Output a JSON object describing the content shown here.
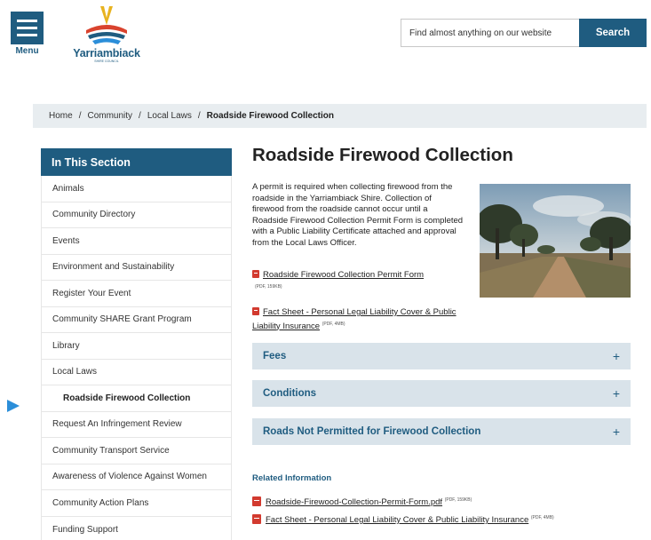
{
  "header": {
    "menu_label": "Menu",
    "logo_name": "Yarriambiack",
    "logo_sub": "SHIRE COUNCIL",
    "search_placeholder": "Find almost anything on our website",
    "search_button": "Search",
    "brand_color": "#1f5c80"
  },
  "breadcrumb": {
    "items": [
      "Home",
      "Community",
      "Local Laws"
    ],
    "current": "Roadside Firewood Collection"
  },
  "sidebar": {
    "heading": "In This Section",
    "items": [
      {
        "label": "Animals"
      },
      {
        "label": "Community Directory"
      },
      {
        "label": "Events"
      },
      {
        "label": "Environment and Sustainability"
      },
      {
        "label": "Register Your Event"
      },
      {
        "label": "Community SHARE Grant Program"
      },
      {
        "label": "Library"
      },
      {
        "label": "Local Laws"
      },
      {
        "label": "Roadside Firewood Collection",
        "active": true
      },
      {
        "label": "Request An Infringement Review"
      },
      {
        "label": "Community Transport Service"
      },
      {
        "label": "Awareness of Violence Against Women"
      },
      {
        "label": "Community Action Plans"
      },
      {
        "label": "Funding Support"
      }
    ]
  },
  "main": {
    "title": "Roadside Firewood Collection",
    "intro": "A permit is required when collecting firewood from the roadside in the Yarriambiack Shire. Collection of firewood from the roadside cannot occur until a Roadside Firewood Collection Permit Form is completed with a Public Liability Certificate attached and approval from the Local Laws Officer.",
    "doc1": {
      "label": "Roadside Firewood Collection Permit Form",
      "meta": "(PDF, 159KB)"
    },
    "doc2": {
      "label": "Fact Sheet - Personal Legal Liability Cover & Public Liability Insurance",
      "meta": "(PDF, 4MB)"
    },
    "accordions": [
      {
        "label": "Fees",
        "icon": "+"
      },
      {
        "label": "Conditions",
        "icon": "+"
      },
      {
        "label": "Roads Not Permitted for Firewood Collection",
        "icon": "+"
      }
    ],
    "related": {
      "title": "Related Information",
      "links": [
        {
          "label": "Roadside-Firewood-Collection-Permit-Form.pdf",
          "meta": "(PDF, 159KB)"
        },
        {
          "label": "Fact Sheet - Personal Legal Liability Cover & Public Liability Insurance",
          "meta": "(PDF, 4MB)"
        }
      ]
    }
  }
}
